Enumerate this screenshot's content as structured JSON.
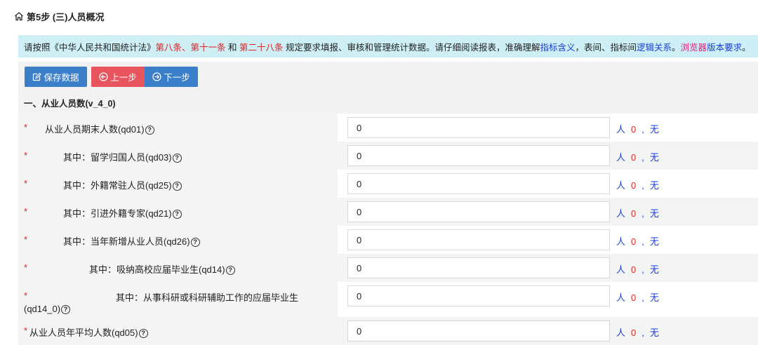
{
  "header": {
    "title": "第5步 (三)人员概况"
  },
  "notice": {
    "parts": [
      {
        "text": "请按照《中华人民共和国统计法》",
        "color": "#222222"
      },
      {
        "text": "第八条、第十一条",
        "color": "#e02020"
      },
      {
        "text": " 和 ",
        "color": "#222222"
      },
      {
        "text": "第二十八条",
        "color": "#e02020"
      },
      {
        "text": " 规定要求填报、审核和管理统计数据。请仔细阅读报表，准确理解",
        "color": "#222222"
      },
      {
        "text": "指标含义",
        "color": "#1a3fd6"
      },
      {
        "text": "，表间、指标间",
        "color": "#222222"
      },
      {
        "text": "逻辑关系",
        "color": "#1a3fd6"
      },
      {
        "text": "。",
        "color": "#222222"
      },
      {
        "text": "浏览器",
        "color": "#e0207a"
      },
      {
        "text": "版本要求",
        "color": "#1a3fd6"
      },
      {
        "text": "。",
        "color": "#222222"
      }
    ]
  },
  "toolbar": {
    "save_label": "保存数据",
    "prev_label": "上一步",
    "next_label": "下一步"
  },
  "section": {
    "title": "一、从业人员数(v_4_0)"
  },
  "rows": [
    {
      "required": "*",
      "label": "从业人员期末人数(qd01)",
      "value": "0",
      "unit": "人",
      "count": "0",
      "sep": ",",
      "status": "无"
    },
    {
      "required": "*",
      "label": "其中：留学归国人员(qd03)",
      "value": "0",
      "unit": "人",
      "count": "0",
      "sep": ",",
      "status": "无"
    },
    {
      "required": "*",
      "label": "其中：外籍常驻人员(qd25)",
      "value": "0",
      "unit": "人",
      "count": "0",
      "sep": ",",
      "status": "无"
    },
    {
      "required": "*",
      "label": "其中：引进外籍专家(qd21)",
      "value": "0",
      "unit": "人",
      "count": "0",
      "sep": ",",
      "status": "无"
    },
    {
      "required": "*",
      "label": "其中：当年新增从业人员(qd26)",
      "value": "0",
      "unit": "人",
      "count": "0",
      "sep": ",",
      "status": "无"
    },
    {
      "required": "*",
      "label": "其中：吸纳高校应届毕业生(qd14)",
      "value": "0",
      "unit": "人",
      "count": "0",
      "sep": ",",
      "status": "无"
    },
    {
      "required": "*",
      "label": "其中：从事科研或科研辅助工作的应届毕业生",
      "label2": "(qd14_0)",
      "value": "0",
      "unit": "人",
      "count": "0",
      "sep": ",",
      "status": "无"
    },
    {
      "required": "*",
      "label": "从业人员年平均人数(qd05)",
      "value": "0",
      "unit": "人",
      "count": "0",
      "sep": ",",
      "status": "无"
    }
  ]
}
